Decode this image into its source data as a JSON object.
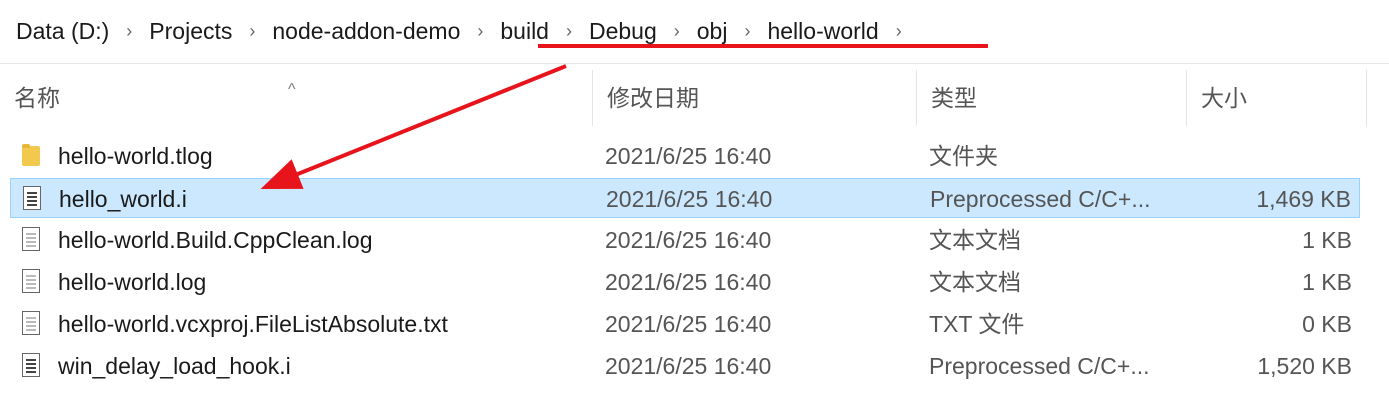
{
  "breadcrumb": {
    "items": [
      "Data (D:)",
      "Projects",
      "node-addon-demo",
      "build",
      "Debug",
      "obj",
      "hello-world"
    ],
    "separator": "›"
  },
  "columns": {
    "name": "名称",
    "date": "修改日期",
    "type": "类型",
    "size": "大小",
    "sort_indicator": "^"
  },
  "files": [
    {
      "icon": "folder-icon",
      "name": "hello-world.tlog",
      "date": "2021/6/25 16:40",
      "type": "文件夹",
      "size": "",
      "selected": false
    },
    {
      "icon": "document-icon",
      "name": "hello_world.i",
      "date": "2021/6/25 16:40",
      "type": "Preprocessed C/C+...",
      "size": "1,469 KB",
      "selected": true
    },
    {
      "icon": "text-file-icon",
      "name": "hello-world.Build.CppClean.log",
      "date": "2021/6/25 16:40",
      "type": "文本文档",
      "size": "1 KB",
      "selected": false
    },
    {
      "icon": "text-file-icon",
      "name": "hello-world.log",
      "date": "2021/6/25 16:40",
      "type": "文本文档",
      "size": "1 KB",
      "selected": false
    },
    {
      "icon": "text-file-icon",
      "name": "hello-world.vcxproj.FileListAbsolute.txt",
      "date": "2021/6/25 16:40",
      "type": "TXT 文件",
      "size": "0 KB",
      "selected": false
    },
    {
      "icon": "document-icon",
      "name": "win_delay_load_hook.i",
      "date": "2021/6/25 16:40",
      "type": "Preprocessed C/C+...",
      "size": "1,520 KB",
      "selected": false
    }
  ],
  "annotation_color": "#e8141b",
  "selection_color": "#cce8ff"
}
